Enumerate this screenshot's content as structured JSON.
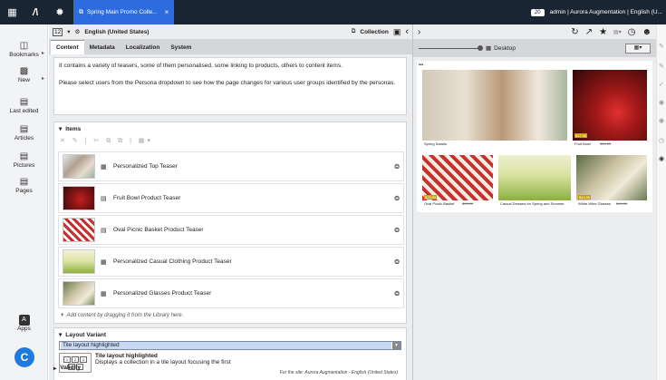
{
  "topbar": {
    "tab_title": "Spring Main Promo Colle...",
    "count_badge": "20",
    "user_label": "admin | Aurora Augmentation | English (U..."
  },
  "sidebar": {
    "items": [
      {
        "label": "Bookmarks"
      },
      {
        "label": "New"
      },
      {
        "label": "Last edited"
      },
      {
        "label": "Articles"
      },
      {
        "label": "Pictures"
      },
      {
        "label": "Pages"
      }
    ],
    "apps_label": "Apps",
    "apps_letter": "A",
    "studio_letter": "C"
  },
  "document": {
    "version": "12",
    "locale": "English (United States)",
    "doctype": "Collection",
    "tabs": [
      "Content",
      "Metadata",
      "Localization",
      "System"
    ],
    "intro_line_1": "It contains a variety of teasers, some of them personalised, some linking to products, others to content items.",
    "intro_line_2": "Please select users from the Persona dropdown to see how the page changes for various user groups identified by the personas.",
    "items_header": "Items",
    "items": [
      {
        "label": "Personalized Top Teaser"
      },
      {
        "label": "Fruit Bowl Product Teaser"
      },
      {
        "label": "Oval Picnic Basket Product Teaser"
      },
      {
        "label": "Personalized Casual Clothing Product Teaser"
      },
      {
        "label": "Personalized Glasses Product Teaser"
      }
    ],
    "add_hint": "Add content by dragging it from the Library here.",
    "layout_header": "Layout Variant",
    "layout_selected": "Tile layout highlighted",
    "layout_title": "Tile layout highlighted",
    "layout_desc": "Displays a collection in a tile layout focusing the first",
    "layout_site": "For the site: Aurora Augmentation - English (United States)",
    "layout_grid_numbers": [
      "1",
      "2",
      "3",
      "4",
      "5"
    ],
    "validity_header": "Validity"
  },
  "preview": {
    "device": "Desktop",
    "tiles": [
      {
        "caption": "Spring Salads",
        "price": "",
        "old_price": ""
      },
      {
        "caption": "Fruit Bowl",
        "price": "$17.98",
        "old_price": "$14.99"
      },
      {
        "caption": "Oval Picnic Basket",
        "price": "$29.99",
        "old_price": "$39.99"
      },
      {
        "caption": "Casual Dresses for Spring and Summer",
        "price": "",
        "old_price": ""
      },
      {
        "caption": "White Wine Glasses",
        "price": "$44.99",
        "old_price": "$49.99"
      }
    ]
  },
  "colors": {
    "topbar_bg": "#1a2533",
    "accent": "#2d6cdf",
    "studio_blue": "#1f7ae0"
  },
  "icons": [
    "apps-grid-icon",
    "studio-logo-icon",
    "sun-icon",
    "bookmark-icon",
    "new-icon",
    "last-edited-icon",
    "articles-icon",
    "pictures-icon",
    "pages-icon",
    "chevron-right-icon",
    "globe-icon",
    "document-icon",
    "refresh-icon",
    "share-icon",
    "star-icon",
    "clock-icon",
    "person-icon"
  ]
}
